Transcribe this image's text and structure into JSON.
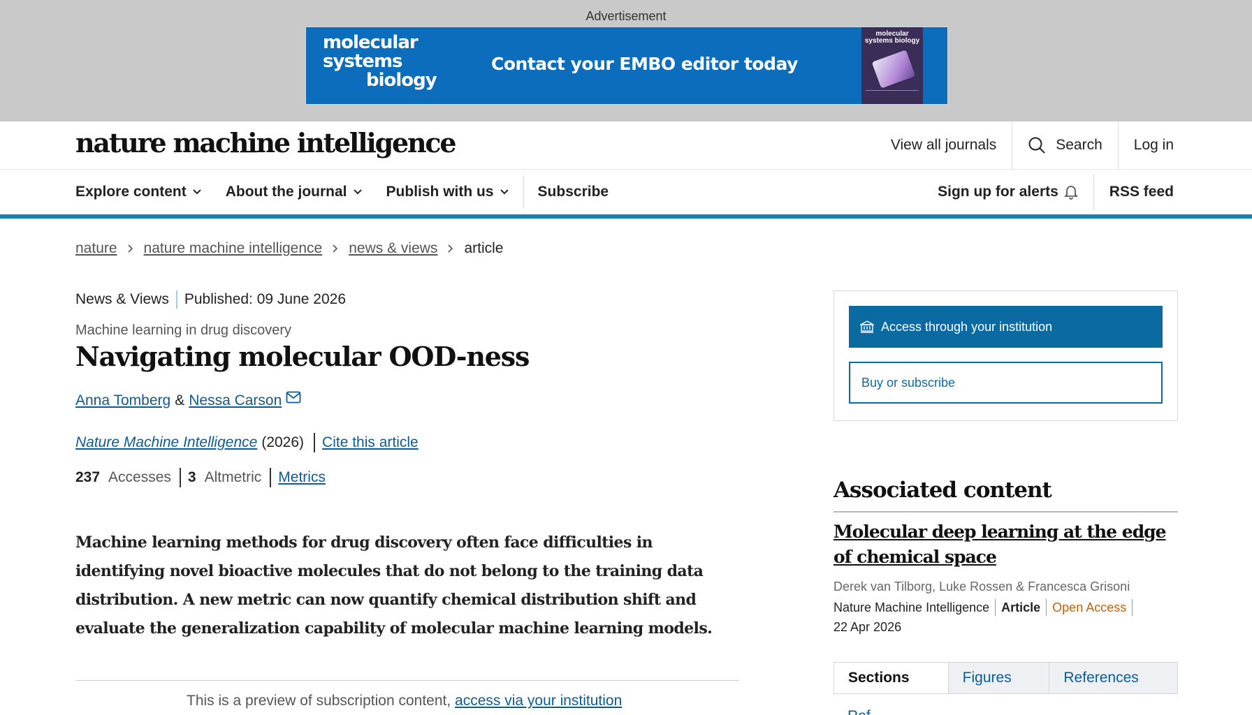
{
  "ad": {
    "label": "Advertisement",
    "logo_lines": [
      "molecular",
      "systems",
      "biology"
    ],
    "cta": "Contact your EMBO editor today",
    "cover_title": "molecular systems biology",
    "brand_color": "#0b6dbb"
  },
  "header": {
    "brand": "nature machine intelligence",
    "view_all": "View all journals",
    "search": "Search",
    "login": "Log in"
  },
  "nav": {
    "explore": "Explore content",
    "about": "About the journal",
    "publish": "Publish with us",
    "subscribe": "Subscribe",
    "alerts": "Sign up for alerts",
    "rss": "RSS feed",
    "accent_color": "#1980b8"
  },
  "breadcrumb": {
    "items": [
      "nature",
      "nature machine intelligence",
      "news & views"
    ],
    "current": "article"
  },
  "article": {
    "type": "News & Views",
    "published": "Published: 09 June 2026",
    "subject": "Machine learning in drug discovery",
    "title": "Navigating molecular OOD-ness",
    "author1": "Anna Tomberg",
    "amp": "&",
    "author2": "Nessa Carson",
    "journal": "Nature Machine Intelligence",
    "year": "(2026)",
    "cite": "Cite this article",
    "accesses_count": "237",
    "accesses_label": "Accesses",
    "altmetric_count": "3",
    "altmetric_label": "Altmetric",
    "metrics_link": "Metrics",
    "abstract": "Machine learning methods for drug discovery often face difficulties in identifying novel bioactive molecules that do not belong to the training data distribution. A new metric can now quantify chemical distribution shift and evaluate the generalization capability of molecular machine learning models.",
    "preview_text": "This is a preview of subscription content, ",
    "preview_link": "access via your institution"
  },
  "access": {
    "institution": "Access through your institution",
    "buy": "Buy or subscribe",
    "button_color": "#0a6aa1"
  },
  "associated": {
    "heading": "Associated content",
    "title": "Molecular deep learning at the edge of chemical space",
    "authors": "Derek van Tilborg, Luke Rossen & Francesca Grisoni",
    "journal": "Nature Machine Intelligence",
    "type": "Article",
    "access": "Open Access",
    "date": "22 Apr 2026",
    "access_color": "#c4610e"
  },
  "tabs": {
    "sections": "Sections",
    "figures": "Figures",
    "references": "References",
    "peek": "Ref"
  }
}
